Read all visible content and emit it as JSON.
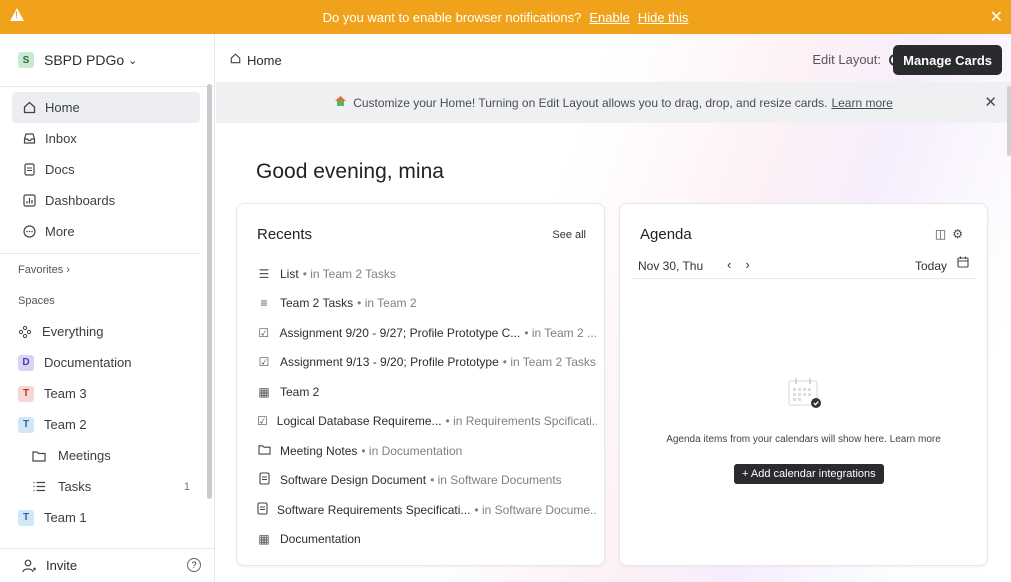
{
  "notification": {
    "message": "Do you want to enable browser notifications?",
    "enable_label": "Enable",
    "hide_label": "Hide this",
    "close_glyph": "✕"
  },
  "workspace": {
    "badge": "S",
    "name": "SBPD PDGo",
    "chevron": "⌄"
  },
  "sidebar": {
    "nav": [
      {
        "label": "Home",
        "icon": "home-icon"
      },
      {
        "label": "Inbox",
        "icon": "inbox-icon"
      },
      {
        "label": "Docs",
        "icon": "docs-icon"
      },
      {
        "label": "Dashboards",
        "icon": "dashboards-icon"
      },
      {
        "label": "More",
        "icon": "more-icon"
      }
    ],
    "favorites_label": "Favorites ›",
    "spaces_label": "Spaces",
    "spaces": [
      {
        "label": "Everything",
        "badge": ""
      },
      {
        "label": "Documentation",
        "badge": "D"
      },
      {
        "label": "Team 3",
        "badge": "T"
      },
      {
        "label": "Team 2",
        "badge": "T"
      },
      {
        "label": "Meetings",
        "badge": ""
      },
      {
        "label": "Tasks",
        "badge": "",
        "count": "1"
      },
      {
        "label": "Team 1",
        "badge": "T"
      }
    ],
    "invite_label": "Invite",
    "help_glyph": "?"
  },
  "topbar": {
    "breadcrumb": "Home",
    "edit_layout_label": "Edit Layout:",
    "manage_cards_label": "Manage Cards"
  },
  "banner": {
    "text": "Customize your Home! Turning on Edit Layout allows you to drag, drop, and resize cards.",
    "link": "Learn more",
    "close_glyph": "✕"
  },
  "greeting": "Good evening, mina",
  "recents": {
    "title": "Recents",
    "see_all": "See all",
    "items": [
      {
        "name": "List",
        "loc": "• in Team 2 Tasks",
        "icon": "list-icon"
      },
      {
        "name": "Team 2 Tasks",
        "loc": "• in Team 2",
        "icon": "lines-icon"
      },
      {
        "name": "Assignment 9/20 - 9/27; Profile Prototype C...",
        "loc": "• in Team 2 ...",
        "icon": "task-icon"
      },
      {
        "name": "Assignment 9/13 - 9/20; Profile Prototype",
        "loc": "• in Team 2 Tasks",
        "icon": "task-icon"
      },
      {
        "name": "Team 2",
        "loc": "",
        "icon": "table-icon"
      },
      {
        "name": "Logical Database Requireme...",
        "loc": "• in Requirements Spcificati...",
        "icon": "task-icon"
      },
      {
        "name": "Meeting Notes",
        "loc": "• in Documentation",
        "icon": "folder-icon"
      },
      {
        "name": "Software Design Document",
        "loc": "• in Software Documents",
        "icon": "doc-icon"
      },
      {
        "name": "Software Requirements Specificati...",
        "loc": "• in Software Docume...",
        "icon": "doc-icon"
      },
      {
        "name": "Documentation",
        "loc": "",
        "icon": "table-icon"
      }
    ]
  },
  "agenda": {
    "title": "Agenda",
    "date": "Nov 30, Thu",
    "prev_glyph": "‹",
    "next_glyph": "›",
    "today_label": "Today",
    "empty_message": "Agenda items from your calendars will show here. Learn more",
    "add_button": "+ Add calendar integrations"
  }
}
